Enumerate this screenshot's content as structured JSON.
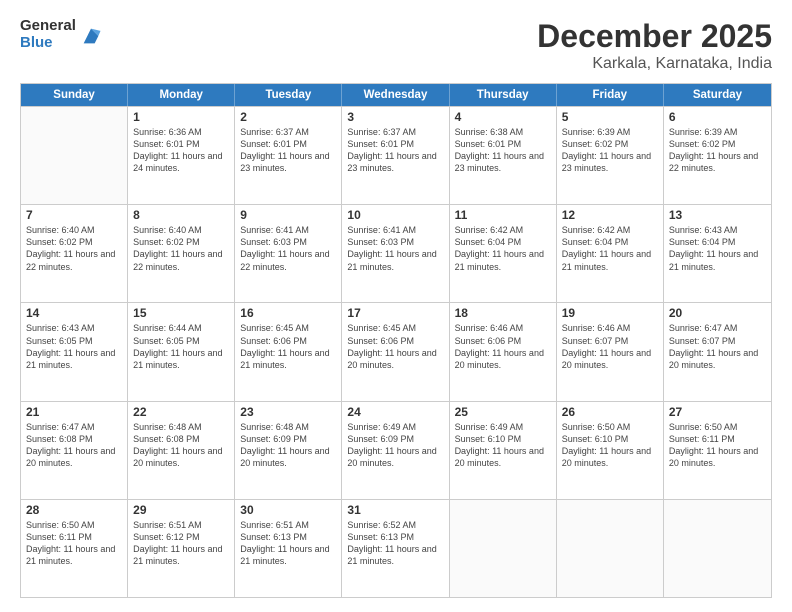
{
  "logo": {
    "general": "General",
    "blue": "Blue"
  },
  "title": "December 2025",
  "subtitle": "Karkala, Karnataka, India",
  "header_days": [
    "Sunday",
    "Monday",
    "Tuesday",
    "Wednesday",
    "Thursday",
    "Friday",
    "Saturday"
  ],
  "rows": [
    [
      {
        "day": "",
        "empty": true
      },
      {
        "day": "1",
        "sunrise": "6:36 AM",
        "sunset": "6:01 PM",
        "daylight": "11 hours and 24 minutes."
      },
      {
        "day": "2",
        "sunrise": "6:37 AM",
        "sunset": "6:01 PM",
        "daylight": "11 hours and 23 minutes."
      },
      {
        "day": "3",
        "sunrise": "6:37 AM",
        "sunset": "6:01 PM",
        "daylight": "11 hours and 23 minutes."
      },
      {
        "day": "4",
        "sunrise": "6:38 AM",
        "sunset": "6:01 PM",
        "daylight": "11 hours and 23 minutes."
      },
      {
        "day": "5",
        "sunrise": "6:39 AM",
        "sunset": "6:02 PM",
        "daylight": "11 hours and 23 minutes."
      },
      {
        "day": "6",
        "sunrise": "6:39 AM",
        "sunset": "6:02 PM",
        "daylight": "11 hours and 22 minutes."
      }
    ],
    [
      {
        "day": "7",
        "sunrise": "6:40 AM",
        "sunset": "6:02 PM",
        "daylight": "11 hours and 22 minutes."
      },
      {
        "day": "8",
        "sunrise": "6:40 AM",
        "sunset": "6:02 PM",
        "daylight": "11 hours and 22 minutes."
      },
      {
        "day": "9",
        "sunrise": "6:41 AM",
        "sunset": "6:03 PM",
        "daylight": "11 hours and 22 minutes."
      },
      {
        "day": "10",
        "sunrise": "6:41 AM",
        "sunset": "6:03 PM",
        "daylight": "11 hours and 21 minutes."
      },
      {
        "day": "11",
        "sunrise": "6:42 AM",
        "sunset": "6:04 PM",
        "daylight": "11 hours and 21 minutes."
      },
      {
        "day": "12",
        "sunrise": "6:42 AM",
        "sunset": "6:04 PM",
        "daylight": "11 hours and 21 minutes."
      },
      {
        "day": "13",
        "sunrise": "6:43 AM",
        "sunset": "6:04 PM",
        "daylight": "11 hours and 21 minutes."
      }
    ],
    [
      {
        "day": "14",
        "sunrise": "6:43 AM",
        "sunset": "6:05 PM",
        "daylight": "11 hours and 21 minutes."
      },
      {
        "day": "15",
        "sunrise": "6:44 AM",
        "sunset": "6:05 PM",
        "daylight": "11 hours and 21 minutes."
      },
      {
        "day": "16",
        "sunrise": "6:45 AM",
        "sunset": "6:06 PM",
        "daylight": "11 hours and 21 minutes."
      },
      {
        "day": "17",
        "sunrise": "6:45 AM",
        "sunset": "6:06 PM",
        "daylight": "11 hours and 20 minutes."
      },
      {
        "day": "18",
        "sunrise": "6:46 AM",
        "sunset": "6:06 PM",
        "daylight": "11 hours and 20 minutes."
      },
      {
        "day": "19",
        "sunrise": "6:46 AM",
        "sunset": "6:07 PM",
        "daylight": "11 hours and 20 minutes."
      },
      {
        "day": "20",
        "sunrise": "6:47 AM",
        "sunset": "6:07 PM",
        "daylight": "11 hours and 20 minutes."
      }
    ],
    [
      {
        "day": "21",
        "sunrise": "6:47 AM",
        "sunset": "6:08 PM",
        "daylight": "11 hours and 20 minutes."
      },
      {
        "day": "22",
        "sunrise": "6:48 AM",
        "sunset": "6:08 PM",
        "daylight": "11 hours and 20 minutes."
      },
      {
        "day": "23",
        "sunrise": "6:48 AM",
        "sunset": "6:09 PM",
        "daylight": "11 hours and 20 minutes."
      },
      {
        "day": "24",
        "sunrise": "6:49 AM",
        "sunset": "6:09 PM",
        "daylight": "11 hours and 20 minutes."
      },
      {
        "day": "25",
        "sunrise": "6:49 AM",
        "sunset": "6:10 PM",
        "daylight": "11 hours and 20 minutes."
      },
      {
        "day": "26",
        "sunrise": "6:50 AM",
        "sunset": "6:10 PM",
        "daylight": "11 hours and 20 minutes."
      },
      {
        "day": "27",
        "sunrise": "6:50 AM",
        "sunset": "6:11 PM",
        "daylight": "11 hours and 20 minutes."
      }
    ],
    [
      {
        "day": "28",
        "sunrise": "6:50 AM",
        "sunset": "6:11 PM",
        "daylight": "11 hours and 21 minutes."
      },
      {
        "day": "29",
        "sunrise": "6:51 AM",
        "sunset": "6:12 PM",
        "daylight": "11 hours and 21 minutes."
      },
      {
        "day": "30",
        "sunrise": "6:51 AM",
        "sunset": "6:13 PM",
        "daylight": "11 hours and 21 minutes."
      },
      {
        "day": "31",
        "sunrise": "6:52 AM",
        "sunset": "6:13 PM",
        "daylight": "11 hours and 21 minutes."
      },
      {
        "day": "",
        "empty": true
      },
      {
        "day": "",
        "empty": true
      },
      {
        "day": "",
        "empty": true
      }
    ]
  ]
}
